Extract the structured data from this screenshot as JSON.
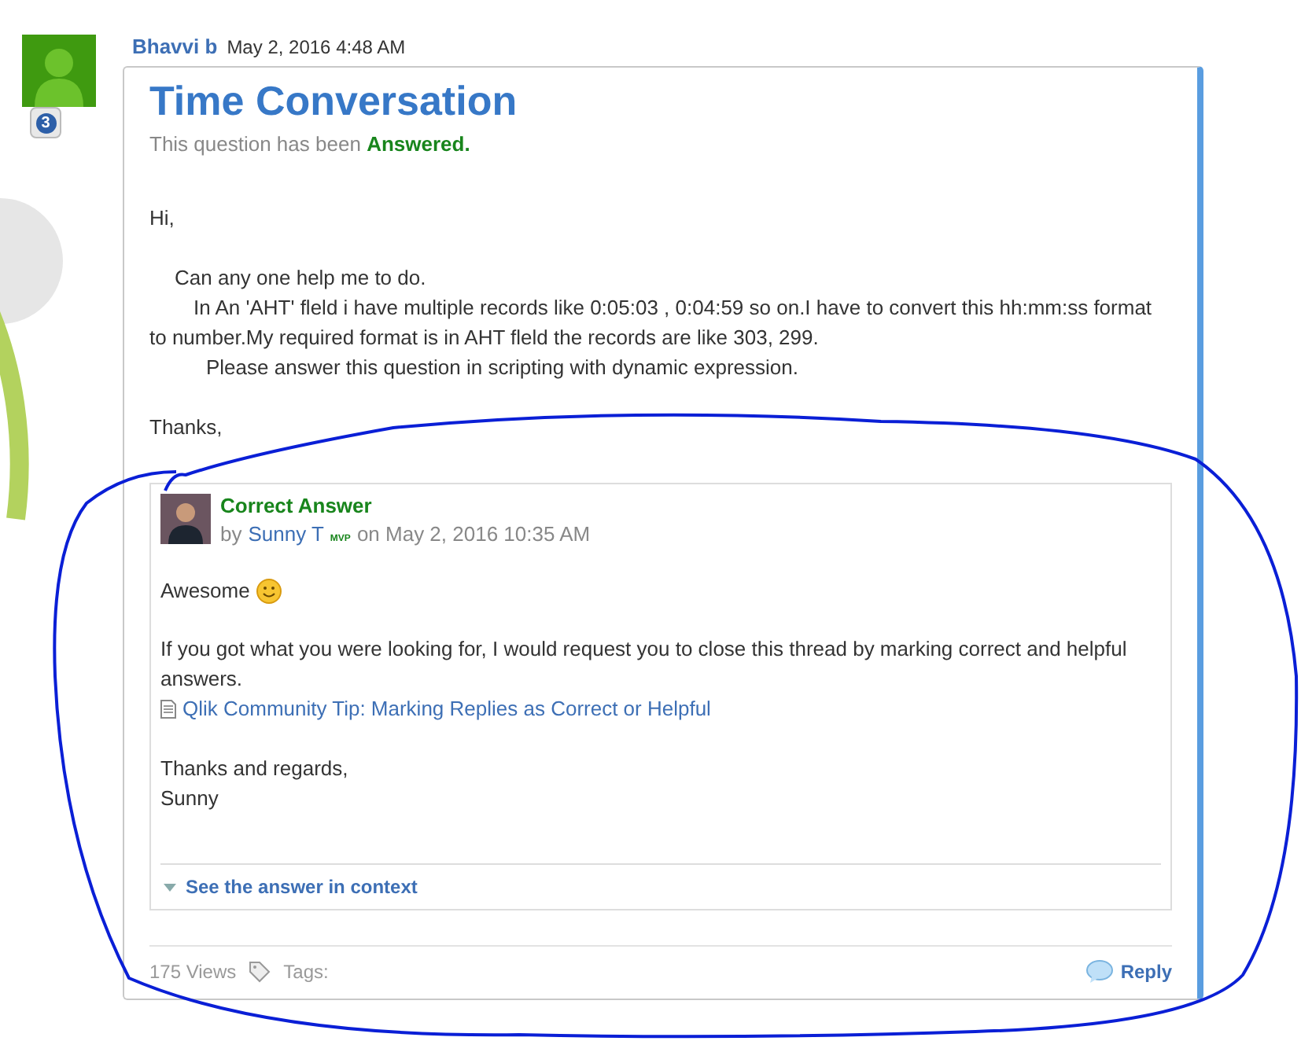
{
  "post": {
    "author": "Bhavvi b",
    "date": "May 2, 2016 4:48 AM",
    "badge": "3",
    "title": "Time Conversation",
    "status_prefix": "This question has been",
    "status": "Answered.",
    "body": [
      "Hi,",
      "Can any one help me to do.",
      "In An 'AHT' fleld i have multiple records like 0:05:03 , 0:04:59 so on.I have to convert this hh:mm:ss format to number.My required format is in AHT fleld the records are like 303, 299.",
      "Please answer this question in scripting with dynamic expression.",
      "Thanks,"
    ]
  },
  "answer": {
    "heading": "Correct Answer",
    "by": "by",
    "author": "Sunny T",
    "author_badge": "MVP",
    "date": "on May 2, 2016 10:35 AM",
    "greeting": "Awesome",
    "text": "If you got what you were looking for, I would request you to close this thread by marking correct and helpful answers.",
    "tip_link": "Qlik Community Tip: Marking Replies as Correct or Helpful",
    "closing": [
      "Thanks and regards,",
      "Sunny"
    ],
    "context_link": "See the answer in context"
  },
  "footer": {
    "views": "175 Views",
    "tags": "Tags:",
    "reply": "Reply"
  }
}
